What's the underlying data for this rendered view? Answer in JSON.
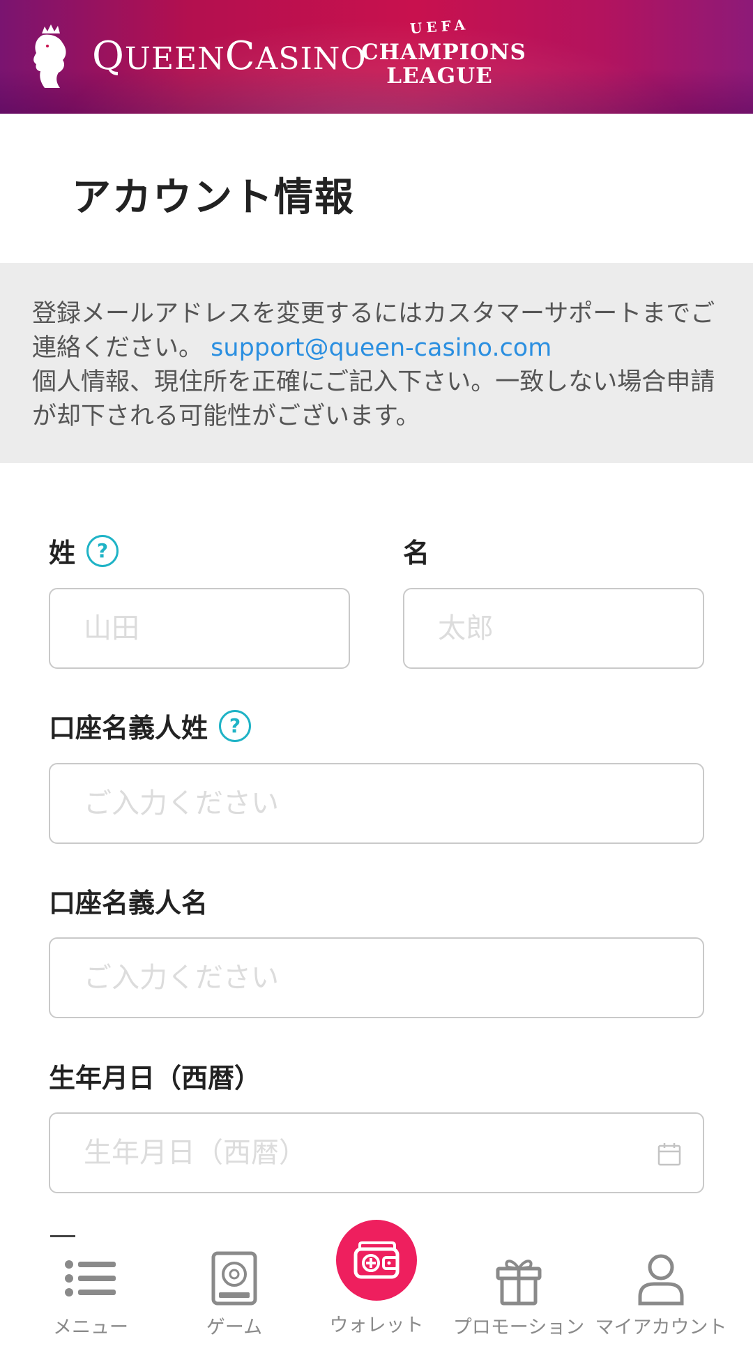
{
  "header": {
    "brand_main": "QueenCasino",
    "brand_cap1": "Q",
    "brand_rest1": "UEEN",
    "brand_cap2": "C",
    "brand_rest2": "ASINO",
    "partner_top": "UEFA",
    "partner_line1": "CHAMPIONS",
    "partner_line2": "LEAGUE"
  },
  "page": {
    "title": "アカウント情報"
  },
  "notice": {
    "line1": "登録メールアドレスを変更するにはカスタマーサポートまでご連絡ください。",
    "email": "support@queen-casino.com",
    "line2": "個人情報、現住所を正確にご記入下さい。一致しない場合申請が却下される可能性がございます。"
  },
  "form": {
    "last_name_label": "姓",
    "last_name_placeholder": "山田",
    "first_name_label": "名",
    "first_name_placeholder": "太郎",
    "account_last_label": "口座名義人姓",
    "account_last_placeholder": "ご入力ください",
    "account_first_label": "口座名義人名",
    "account_first_placeholder": "ご入力ください",
    "birthdate_label": "生年月日（西暦）",
    "birthdate_placeholder": "生年月日（西暦）",
    "help_glyph": "?"
  },
  "nav": {
    "menu": "メニュー",
    "game": "ゲーム",
    "wallet": "ウォレット",
    "promotion": "プロモーション",
    "my_account": "マイアカウント"
  },
  "colors": {
    "accent": "#ee1f5e",
    "link": "#2b8fe0",
    "help": "#1fb3c6",
    "banner": "#c8114e"
  }
}
